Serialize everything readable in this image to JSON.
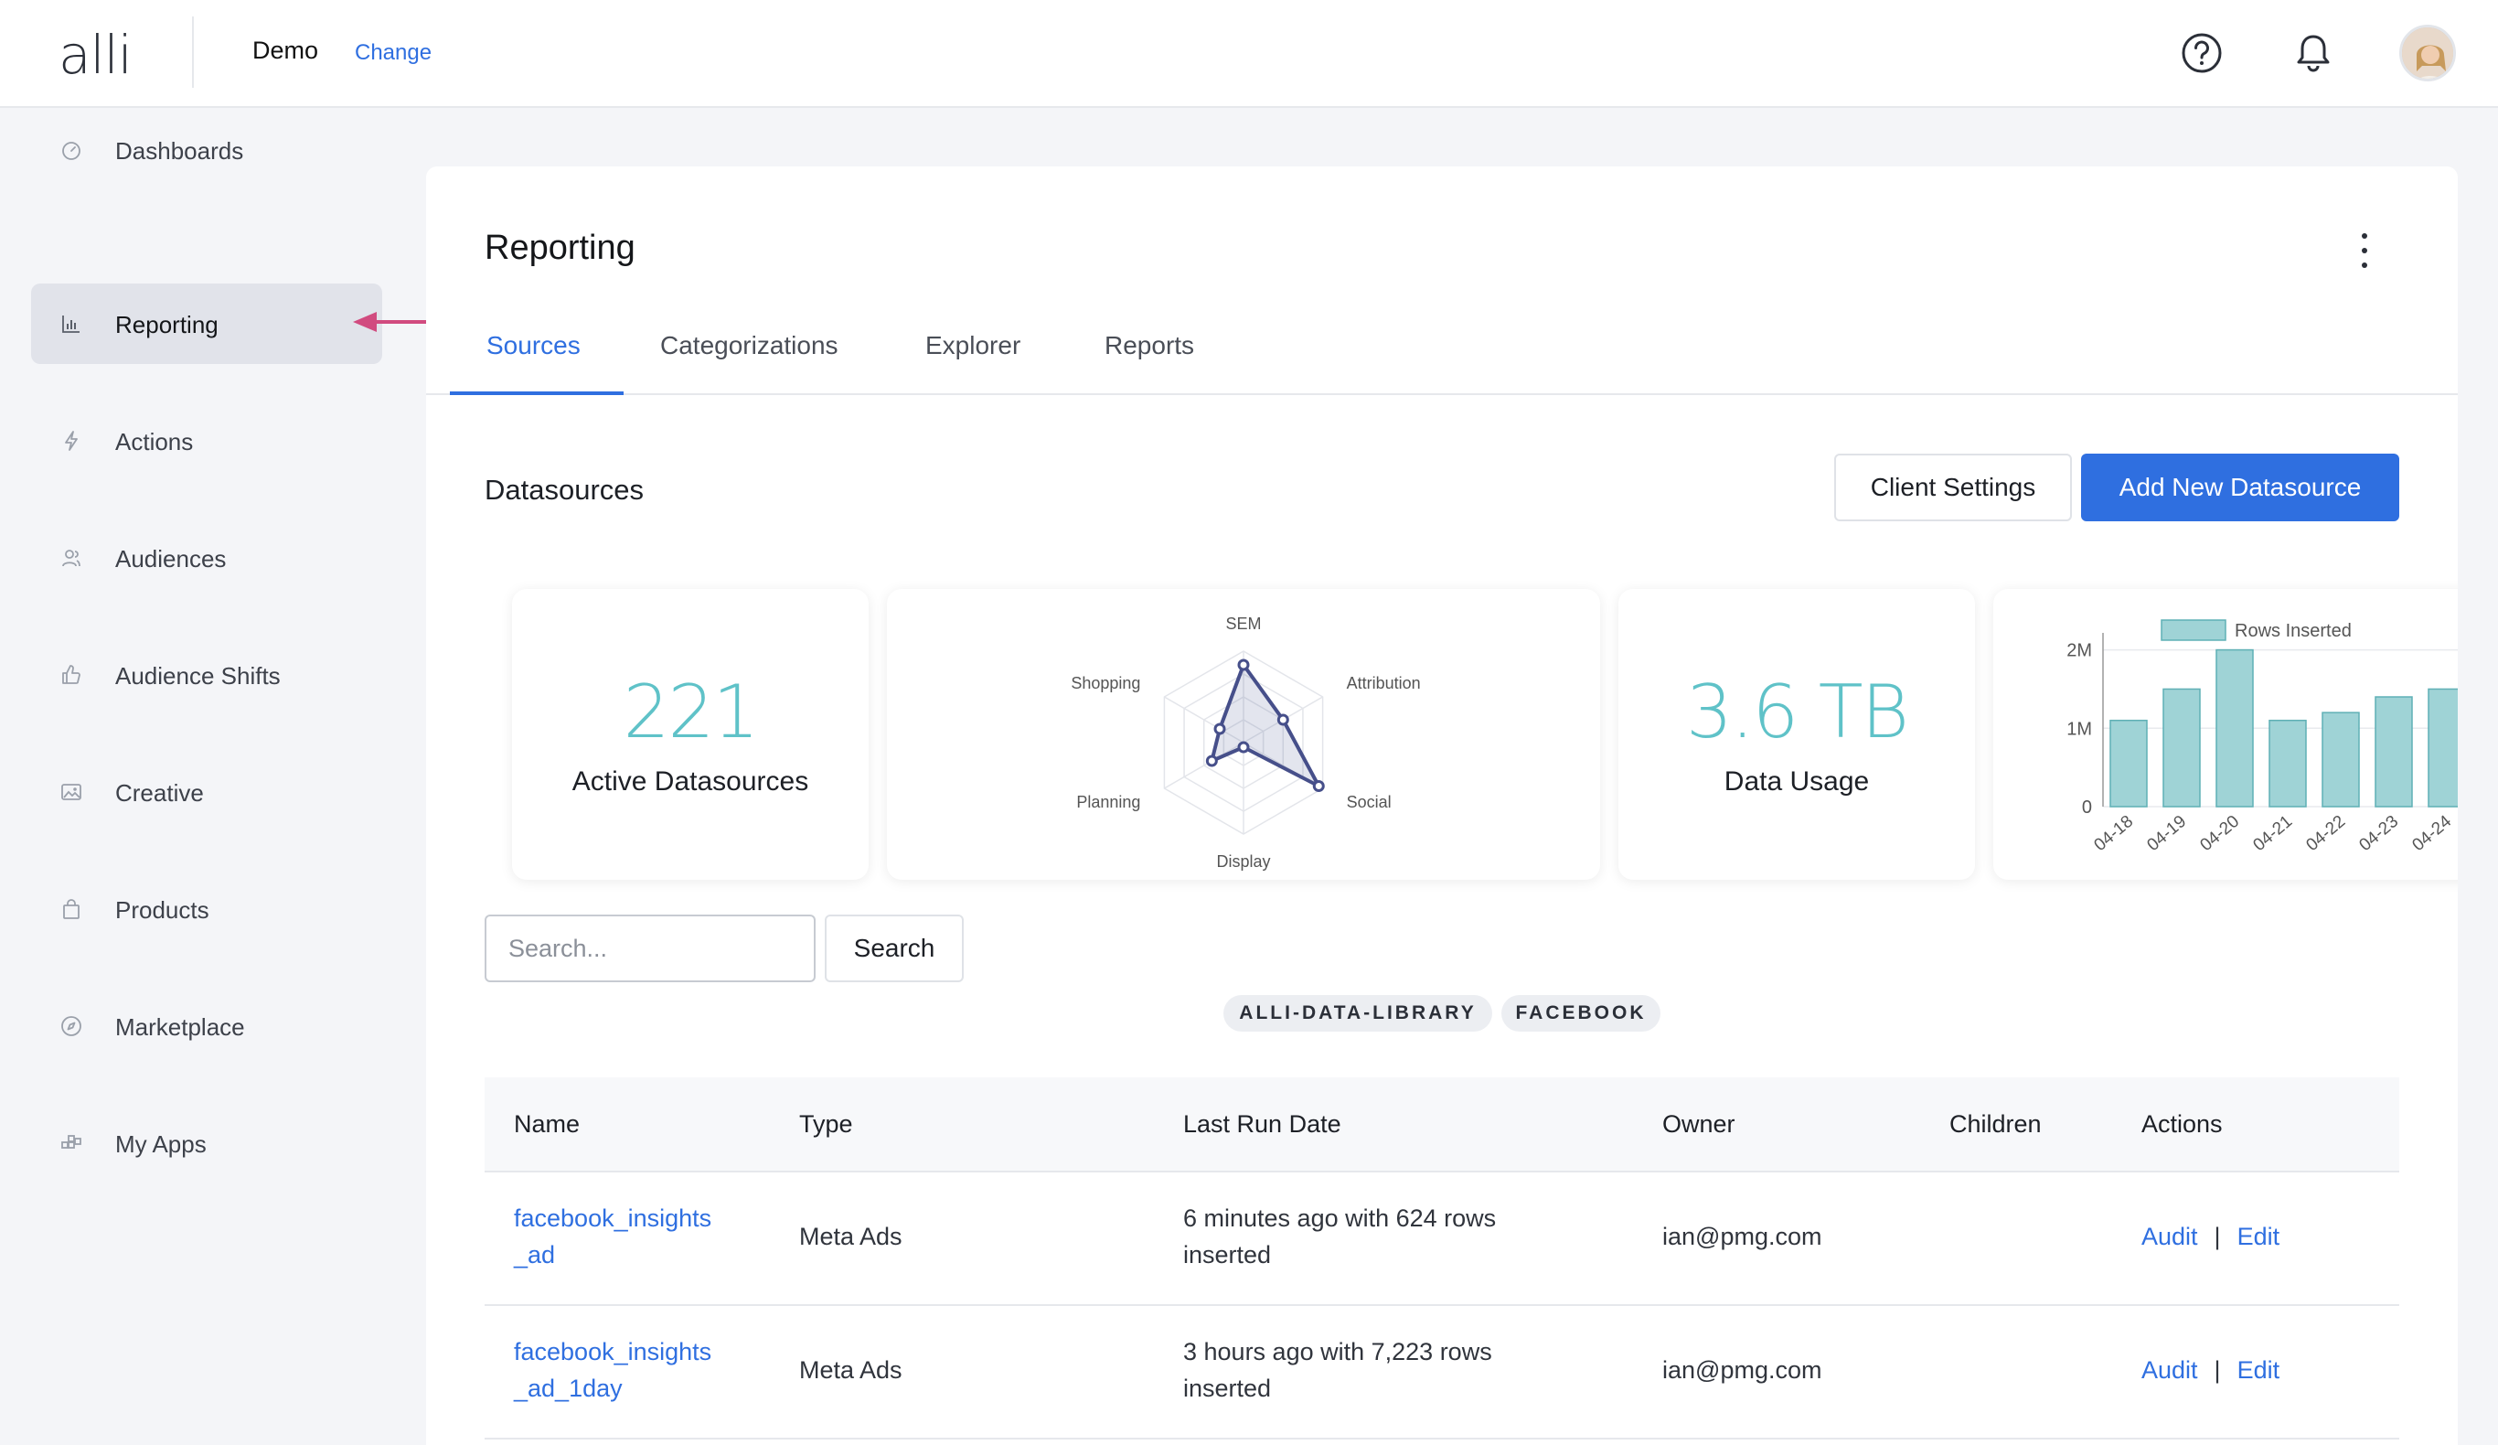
{
  "header": {
    "logo": "alli",
    "client_name": "Demo",
    "change_label": "Change"
  },
  "sidebar": {
    "items": [
      {
        "label": "Dashboards",
        "icon": "gauge-icon"
      },
      {
        "label": "Reporting",
        "icon": "bar-chart-icon",
        "active": true
      },
      {
        "label": "Actions",
        "icon": "lightning-icon"
      },
      {
        "label": "Audiences",
        "icon": "users-icon"
      },
      {
        "label": "Audience Shifts",
        "icon": "thumbs-up-icon"
      },
      {
        "label": "Creative",
        "icon": "image-icon"
      },
      {
        "label": "Products",
        "icon": "bag-icon"
      },
      {
        "label": "Marketplace",
        "icon": "compass-icon"
      },
      {
        "label": "My Apps",
        "icon": "apps-icon"
      }
    ]
  },
  "main": {
    "title": "Reporting",
    "tabs": [
      {
        "label": "Sources",
        "active": true
      },
      {
        "label": "Categorizations"
      },
      {
        "label": "Explorer"
      },
      {
        "label": "Reports"
      }
    ],
    "section_title": "Datasources",
    "client_settings_label": "Client Settings",
    "add_datasource_label": "Add New Datasource",
    "stats": {
      "active_datasources_value": "221",
      "active_datasources_label": "Active Datasources",
      "data_usage_value": "3.6 TB",
      "data_usage_label": "Data Usage"
    },
    "search": {
      "placeholder": "Search...",
      "button_label": "Search"
    },
    "chips": [
      "ALLI-DATA-LIBRARY",
      "FACEBOOK"
    ],
    "table": {
      "headers": [
        "Name",
        "Type",
        "Last Run Date",
        "Owner",
        "Children",
        "Actions"
      ],
      "rows": [
        {
          "name_line1": "facebook_insights",
          "name_line2": "_ad",
          "type": "Meta Ads",
          "last_run_line1": "6 minutes ago with 624 rows",
          "last_run_line2": "inserted",
          "owner": "ian@pmg.com",
          "children": "",
          "audit": "Audit",
          "edit": "Edit"
        },
        {
          "name_line1": "facebook_insights",
          "name_line2": "_ad_1day",
          "type": "Meta Ads",
          "last_run_line1": "3 hours ago with 7,223 rows",
          "last_run_line2": "inserted",
          "owner": "ian@pmg.com",
          "children": "",
          "audit": "Audit",
          "edit": "Edit"
        }
      ]
    }
  },
  "chart_data": [
    {
      "type": "radar",
      "categories": [
        "SEM",
        "Attribution",
        "Social",
        "Display",
        "Planning",
        "Shopping"
      ],
      "values": [
        0.85,
        0.5,
        0.95,
        0.05,
        0.4,
        0.3
      ],
      "ylim": [
        0,
        1
      ],
      "color": "#464f8a"
    },
    {
      "type": "bar",
      "categories": [
        "04-18",
        "04-19",
        "04-20",
        "04-21",
        "04-22",
        "04-23",
        "04-24"
      ],
      "series": [
        {
          "name": "Rows Inserted",
          "values": [
            1100000,
            1500000,
            2000000,
            1100000,
            1200000,
            1400000,
            1500000
          ]
        }
      ],
      "ylim": [
        0,
        2100000
      ],
      "yticks": [
        "0",
        "1M",
        "2M"
      ],
      "legend": "top",
      "color": "#9fd3d6"
    }
  ]
}
